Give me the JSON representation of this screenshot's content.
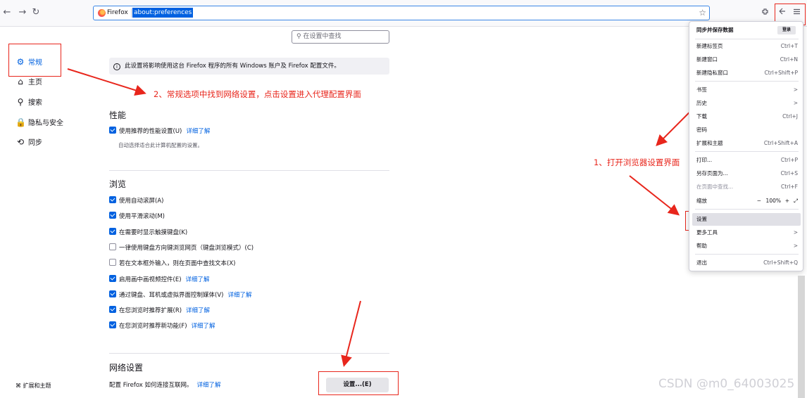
{
  "toolbar": {
    "back_icon": "←",
    "forward_icon": "→",
    "reload_icon": "↻",
    "identity_label": "Firefox",
    "url": "about:preferences",
    "star_icon": "☆"
  },
  "sidebar": {
    "items": [
      {
        "label": "常规",
        "icon": "⚙"
      },
      {
        "label": "主页",
        "icon": "⌂"
      },
      {
        "label": "搜索",
        "icon": "⚲"
      },
      {
        "label": "隐私与安全",
        "icon": "🔒"
      },
      {
        "label": "同步",
        "icon": "⟲"
      }
    ],
    "footer_label": "扩展和主题"
  },
  "main": {
    "search_placeholder": "在设置中查找",
    "info_banner": "此设置将影响使用这台 Firefox 程序的所有 Windows 账户及 Firefox 配置文件。",
    "performance": {
      "title": "性能",
      "option_label": "使用推荐的性能设置(U)",
      "learn_more": "详细了解",
      "note": "自动选择适合此计算机配置的设置。"
    },
    "browsing": {
      "title": "浏览",
      "options": [
        {
          "label": "使用自动滚屏(A)",
          "checked": true,
          "link": ""
        },
        {
          "label": "使用平滑滚动(M)",
          "checked": true,
          "link": ""
        },
        {
          "label": "在需要时显示触摸键盘(K)",
          "checked": true,
          "link": ""
        },
        {
          "label": "一律使用键盘方向键浏览网页（键盘浏览模式）(C)",
          "checked": false,
          "link": ""
        },
        {
          "label": "若在文本框外输入，则在页面中查找文本(X)",
          "checked": false,
          "link": ""
        },
        {
          "label": "启用画中画视频控件(E)",
          "checked": true,
          "link": "详细了解"
        },
        {
          "label": "通过键盘、耳机或虚拟界面控制媒体(V)",
          "checked": true,
          "link": "详细了解"
        },
        {
          "label": "在您浏览时推荐扩展(R)",
          "checked": true,
          "link": "详细了解"
        },
        {
          "label": "在您浏览时推荐新功能(F)",
          "checked": true,
          "link": "详细了解"
        }
      ]
    },
    "network": {
      "title": "网络设置",
      "description": "配置 Firefox 如何连接互联网。",
      "learn_more": "详细了解",
      "button_label": "设置...(E)"
    }
  },
  "annotations": {
    "step1": "1、打开浏览器设置界面",
    "step2": "2、常规选项中找到网络设置，点击设置进入代理配置界面"
  },
  "menu": {
    "header": "同步并保存数据",
    "sync_button": "登录",
    "groups": [
      [
        {
          "label": "新建标签页",
          "shortcut": "Ctrl+T"
        },
        {
          "label": "新建窗口",
          "shortcut": "Ctrl+N"
        },
        {
          "label": "新建隐私窗口",
          "shortcut": "Ctrl+Shift+P"
        }
      ],
      [
        {
          "label": "书签",
          "shortcut": ">"
        },
        {
          "label": "历史",
          "shortcut": ">"
        },
        {
          "label": "下载",
          "shortcut": "Ctrl+J"
        },
        {
          "label": "密码",
          "shortcut": ""
        },
        {
          "label": "扩展和主题",
          "shortcut": "Ctrl+Shift+A"
        }
      ],
      [
        {
          "label": "打印...",
          "shortcut": "Ctrl+P"
        },
        {
          "label": "另存页面为...",
          "shortcut": "Ctrl+S"
        },
        {
          "label": "在页面中查找...",
          "shortcut": "Ctrl+F"
        }
      ]
    ],
    "zoom": {
      "label": "缩放",
      "minus": "−",
      "value": "100%",
      "plus": "+",
      "fullscreen": "⤢"
    },
    "settings": "设置",
    "more_tools": "更多工具",
    "help": "帮助",
    "exit": {
      "label": "退出",
      "shortcut": "Ctrl+Shift+Q"
    }
  },
  "watermark": "CSDN @m0_64003025"
}
